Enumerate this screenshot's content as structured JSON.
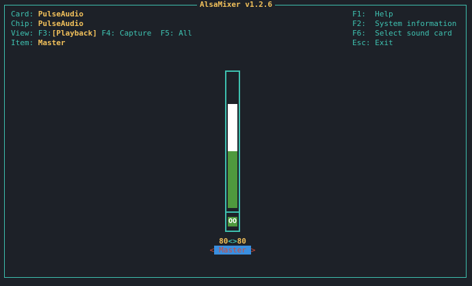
{
  "app": {
    "title": "AlsaMixer v1.2.6"
  },
  "info": {
    "card_label": "Card: ",
    "card_value": "PulseAudio",
    "chip_label": "Chip: ",
    "chip_value": "PulseAudio",
    "view_label": "View: F3:",
    "view_playback": "[Playback]",
    "view_capture": " F4: Capture",
    "view_all": "  F5: All",
    "item_label": "Item: ",
    "item_value": "Master"
  },
  "shortcuts": [
    {
      "key": "F1:  ",
      "label": "Help"
    },
    {
      "key": "F2:  ",
      "label": "System information"
    },
    {
      "key": "F6:  ",
      "label": "Select sound card"
    },
    {
      "key": "Esc: ",
      "label": "Exit"
    }
  ],
  "channel": {
    "name": "Master",
    "left_level": "80",
    "right_level": "80",
    "link_symbol": "<>",
    "mute_state": "OO",
    "volume_fraction": 0.8,
    "left_arrow": "<",
    "right_arrow": ">"
  },
  "colors": {
    "background": "#1d2128",
    "accent": "#3ec1b0",
    "highlight": "#f2c15b",
    "volume_bar": "#4f9a3e",
    "volume_top": "#ffffff",
    "selected_label_bg": "#3a8fe0",
    "selected_label_fg": "#d04b3b"
  }
}
